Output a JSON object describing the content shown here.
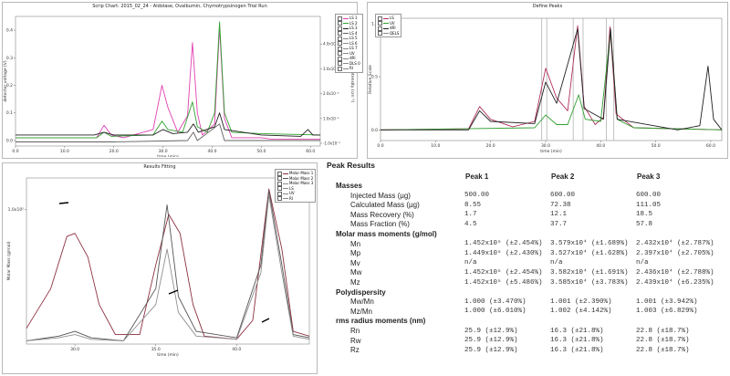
{
  "chart_data": [
    {
      "type": "line",
      "title": "Scrip Chart: 2015_02_24 - Aldolase, Ovalbumin, Chymotrypsinogen Trial Run",
      "xlabel": "time (min)",
      "ylabel": "detector voltage (V)",
      "ylabel_right": "light intensity (cm⁻¹)",
      "xlim": [
        0,
        62
      ],
      "ylim": [
        -0.02,
        0.45
      ],
      "x_ticks": [
        "0.0",
        "10.0",
        "20.0",
        "30.0",
        "40.0",
        "50.0",
        "60.0"
      ],
      "y_ticks": [
        "0.0",
        "0.1",
        "0.2",
        "0.3",
        "0.4"
      ],
      "y_right_ticks": [
        "-1.0x10⁻⁵",
        "1.0x10⁻⁵",
        "2.0x10⁻⁵",
        "3.0x10⁻⁵",
        "4.0x10⁻⁵"
      ],
      "legend": [
        "LS 1",
        "LS 2",
        "LS 3",
        "LS 4",
        "LS 5",
        "LS 6",
        "LS 7",
        "UV",
        "dRI",
        "DLS 0",
        "RI"
      ],
      "legend_position": "top-right",
      "series": [
        {
          "color": "#e040b0",
          "points": [
            [
              0,
              0.01
            ],
            [
              16.5,
              0.01
            ],
            [
              18,
              0.055
            ],
            [
              19.5,
              0.02
            ],
            [
              22,
              0.01
            ],
            [
              28,
              0.04
            ],
            [
              29.8,
              0.2
            ],
            [
              31,
              0.12
            ],
            [
              33,
              0.03
            ],
            [
              35,
              0.09
            ],
            [
              36,
              0.355
            ],
            [
              37,
              0.1
            ],
            [
              38,
              0.02
            ],
            [
              40.5,
              0.06
            ],
            [
              41.5,
              0.41
            ],
            [
              42.5,
              0.08
            ],
            [
              44,
              0.01
            ],
            [
              50,
              0.01
            ],
            [
              52,
              0.005
            ],
            [
              62,
              0.005
            ]
          ]
        },
        {
          "color": "#30a030",
          "points": [
            [
              0,
              0.01
            ],
            [
              16.5,
              0.01
            ],
            [
              18,
              0.03
            ],
            [
              19.5,
              0.015
            ],
            [
              28,
              0.02
            ],
            [
              29.8,
              0.07
            ],
            [
              31,
              0.04
            ],
            [
              34,
              0.03
            ],
            [
              36,
              0.14
            ],
            [
              37,
              0.05
            ],
            [
              39,
              0.03
            ],
            [
              40.5,
              0.1
            ],
            [
              41.5,
              0.43
            ],
            [
              42.5,
              0.1
            ],
            [
              44,
              0.03
            ],
            [
              50,
              0.025
            ],
            [
              62,
              0.02
            ]
          ]
        },
        {
          "color": "#202020",
          "points": [
            [
              0,
              0.02
            ],
            [
              16,
              0.02
            ],
            [
              18,
              0.03
            ],
            [
              20,
              0.02
            ],
            [
              28,
              0.02
            ],
            [
              30,
              0.04
            ],
            [
              32,
              0.025
            ],
            [
              35,
              0.03
            ],
            [
              36.2,
              0.06
            ],
            [
              37.2,
              0.03
            ],
            [
              40.5,
              0.05
            ],
            [
              41.5,
              0.1
            ],
            [
              42.5,
              0.04
            ],
            [
              50,
              0.02
            ],
            [
              58,
              0.015
            ],
            [
              59.5,
              0.04
            ],
            [
              60.5,
              0.02
            ],
            [
              62,
              0.02
            ]
          ]
        },
        {
          "color": "#606060",
          "points": [
            [
              0,
              -0.005
            ],
            [
              20,
              -0.005
            ],
            [
              35,
              0.0
            ],
            [
              36.2,
              0.03
            ],
            [
              37,
              0.0
            ],
            [
              41.5,
              0.06
            ],
            [
              42.5,
              0.0
            ],
            [
              62,
              0.0
            ]
          ]
        }
      ]
    },
    {
      "type": "line",
      "title": "Define Peaks",
      "xlabel": "time (min)",
      "ylabel": "Relative Scale",
      "xlim": [
        0,
        62
      ],
      "ylim": [
        -0.1,
        1.05
      ],
      "x_ticks": [
        "0.0",
        "10.0",
        "20.0",
        "30.0",
        "40.0",
        "50.0",
        "60.0"
      ],
      "y_ticks": [
        "0.0",
        "0.5",
        "1.0"
      ],
      "legend": [
        "LS",
        "UV",
        "dRI",
        "QELS"
      ],
      "legend_position": "top-left",
      "series": [
        {
          "color": "#b03060",
          "points": [
            [
              0,
              0.0
            ],
            [
              16,
              0.01
            ],
            [
              18,
              0.22
            ],
            [
              20,
              0.1
            ],
            [
              24,
              0.03
            ],
            [
              28,
              0.08
            ],
            [
              30,
              0.58
            ],
            [
              32,
              0.3
            ],
            [
              34,
              0.18
            ],
            [
              35.8,
              0.98
            ],
            [
              37,
              0.22
            ],
            [
              39,
              0.05
            ],
            [
              40.5,
              0.12
            ],
            [
              41.7,
              0.97
            ],
            [
              42.8,
              0.15
            ],
            [
              46,
              0.02
            ],
            [
              62,
              0.0
            ]
          ]
        },
        {
          "color": "#30a030",
          "points": [
            [
              0,
              0.0
            ],
            [
              28,
              0.02
            ],
            [
              30,
              0.14
            ],
            [
              32,
              0.05
            ],
            [
              34,
              0.05
            ],
            [
              36,
              0.33
            ],
            [
              37.2,
              0.1
            ],
            [
              40,
              0.08
            ],
            [
              41.8,
              0.93
            ],
            [
              43,
              0.1
            ],
            [
              46,
              0.02
            ],
            [
              62,
              0.0
            ]
          ]
        },
        {
          "color": "#202020",
          "points": [
            [
              0,
              0.0
            ],
            [
              16,
              0.0
            ],
            [
              18,
              0.18
            ],
            [
              20,
              0.08
            ],
            [
              28,
              0.06
            ],
            [
              30,
              0.45
            ],
            [
              32,
              0.25
            ],
            [
              35.8,
              0.95
            ],
            [
              37,
              0.2
            ],
            [
              40.5,
              0.1
            ],
            [
              41.8,
              0.95
            ],
            [
              43,
              0.1
            ],
            [
              54,
              0.0
            ],
            [
              58,
              0.04
            ],
            [
              59.5,
              0.6
            ],
            [
              60.5,
              0.1
            ],
            [
              62,
              0.0
            ]
          ]
        }
      ],
      "peak_markers_x": [
        29.3,
        30.2,
        35.0,
        36.8,
        41.0,
        42.4
      ]
    },
    {
      "type": "line",
      "title": "Results Fitting",
      "xlabel": "time (min)",
      "ylabel": "Molar Mass (g/mol)",
      "xlim": [
        27,
        44.5
      ],
      "y_ticks": [
        "1.0x10⁵"
      ],
      "x_ticks": [
        "30.0",
        "35.0",
        "40.0"
      ],
      "legend": [
        "Molar Mass 1",
        "Molar Mass 2",
        "Molar Mass 3",
        "LS",
        "UV",
        "RI"
      ],
      "legend_position": "top-right",
      "series": [
        {
          "color": "#8b2f3f",
          "points": [
            [
              27,
              0.1
            ],
            [
              28.5,
              0.35
            ],
            [
              29.5,
              0.68
            ],
            [
              30,
              0.7
            ],
            [
              30.8,
              0.55
            ],
            [
              31.5,
              0.25
            ],
            [
              32.5,
              0.06
            ],
            [
              34,
              0.06
            ],
            [
              35,
              0.5
            ],
            [
              35.8,
              0.82
            ],
            [
              36.5,
              0.7
            ],
            [
              37.3,
              0.25
            ],
            [
              38,
              0.05
            ],
            [
              40,
              0.03
            ],
            [
              41,
              0.15
            ],
            [
              42,
              0.98
            ],
            [
              42.8,
              0.6
            ],
            [
              43.5,
              0.08
            ],
            [
              44.5,
              0.05
            ]
          ]
        },
        {
          "color": "#555555",
          "points": [
            [
              27,
              0.02
            ],
            [
              29,
              0.05
            ],
            [
              30,
              0.08
            ],
            [
              31,
              0.04
            ],
            [
              33,
              0.02
            ],
            [
              35,
              0.35
            ],
            [
              35.7,
              0.88
            ],
            [
              36.4,
              0.3
            ],
            [
              37.5,
              0.08
            ],
            [
              40,
              0.04
            ],
            [
              41.5,
              0.5
            ],
            [
              42,
              0.97
            ],
            [
              42.8,
              0.5
            ],
            [
              43.5,
              0.06
            ],
            [
              44.5,
              0.04
            ]
          ]
        },
        {
          "color": "#909090",
          "points": [
            [
              27,
              0.02
            ],
            [
              29,
              0.04
            ],
            [
              30,
              0.06
            ],
            [
              31,
              0.03
            ],
            [
              33,
              0.02
            ],
            [
              35,
              0.25
            ],
            [
              35.7,
              0.6
            ],
            [
              36.4,
              0.2
            ],
            [
              37.5,
              0.05
            ],
            [
              40,
              0.03
            ],
            [
              41.5,
              0.45
            ],
            [
              42,
              0.94
            ],
            [
              42.8,
              0.45
            ],
            [
              43.5,
              0.05
            ],
            [
              44.5,
              0.03
            ]
          ]
        }
      ]
    },
    {
      "type": "table",
      "title": "Peak Results",
      "columns": [
        "Peak 1",
        "Peak 2",
        "Peak 3"
      ],
      "sections": [
        {
          "name": "Masses",
          "rows": [
            {
              "label": "Injected Mass (µg)",
              "values": [
                "500.00",
                "600.00",
                "600.00"
              ]
            },
            {
              "label": "Calculated Mass (µg)",
              "values": [
                "8.55",
                "72.38",
                "111.05"
              ]
            },
            {
              "label": "Mass Recovery (%)",
              "values": [
                "1.7",
                "12.1",
                "18.5"
              ]
            },
            {
              "label": "Mass Fraction (%)",
              "values": [
                "4.5",
                "37.7",
                "57.8"
              ]
            }
          ]
        },
        {
          "name": "Molar mass moments (g/mol)",
          "rows": [
            {
              "label": "Mn",
              "values": [
                "1.452x10⁵ (±2.454%)",
                "3.579x10⁴ (±1.689%)",
                "2.432x10⁴ (±2.787%)"
              ]
            },
            {
              "label": "Mp",
              "values": [
                "1.449x10⁵ (±2.430%)",
                "3.527x10⁴ (±1.628%)",
                "2.397x10⁴ (±2.705%)"
              ]
            },
            {
              "label": "Mv",
              "values": [
                "n/a",
                "n/a",
                "n/a"
              ]
            },
            {
              "label": "Mw",
              "values": [
                "1.452x10⁵ (±2.454%)",
                "3.582x10⁴ (±1.691%)",
                "2.436x10⁴ (±2.788%)"
              ]
            },
            {
              "label": "Mz",
              "values": [
                "1.452x10⁵ (±5.486%)",
                "3.585x10⁴ (±3.783%)",
                "2.439x10⁴ (±6.235%)"
              ]
            }
          ]
        },
        {
          "name": "Polydispersity",
          "rows": [
            {
              "label": "Mw/Mn",
              "values": [
                "1.000 (±3.470%)",
                "1.001 (±2.390%)",
                "1.001 (±3.942%)"
              ]
            },
            {
              "label": "Mz/Mn",
              "values": [
                "1.000 (±6.010%)",
                "1.002 (±4.142%)",
                "1.003 (±6.829%)"
              ]
            }
          ]
        },
        {
          "name": "rms radius moments (nm)",
          "rows": [
            {
              "label": "Rn",
              "values": [
                "25.9 (±12.9%)",
                "16.3 (±21.8%)",
                "22.8 (±18.7%)"
              ]
            },
            {
              "label": "Rw",
              "values": [
                "25.9 (±12.9%)",
                "16.3 (±21.8%)",
                "22.8 (±18.7%)"
              ]
            },
            {
              "label": "Rz",
              "values": [
                "25.9 (±12.9%)",
                "16.3 (±21.8%)",
                "22.8 (±18.7%)"
              ]
            }
          ]
        }
      ]
    }
  ]
}
